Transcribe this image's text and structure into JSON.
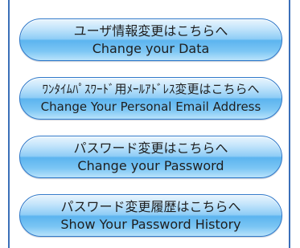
{
  "buttons": [
    {
      "ja": "ユーザ情報変更はこちらへ",
      "en": "Change your Data"
    },
    {
      "ja": "ﾜﾝﾀｲﾑﾊﾟｽﾜｰﾄﾞ用ﾒｰﾙｱﾄﾞﾚｽ変更はこちらへ",
      "en": "Change Your Personal Email Address"
    },
    {
      "ja": "パスワード変更はこちらへ",
      "en": "Change your Password"
    },
    {
      "ja": "パスワード変更履歴はこちらへ",
      "en": "Show Your Password History"
    }
  ]
}
